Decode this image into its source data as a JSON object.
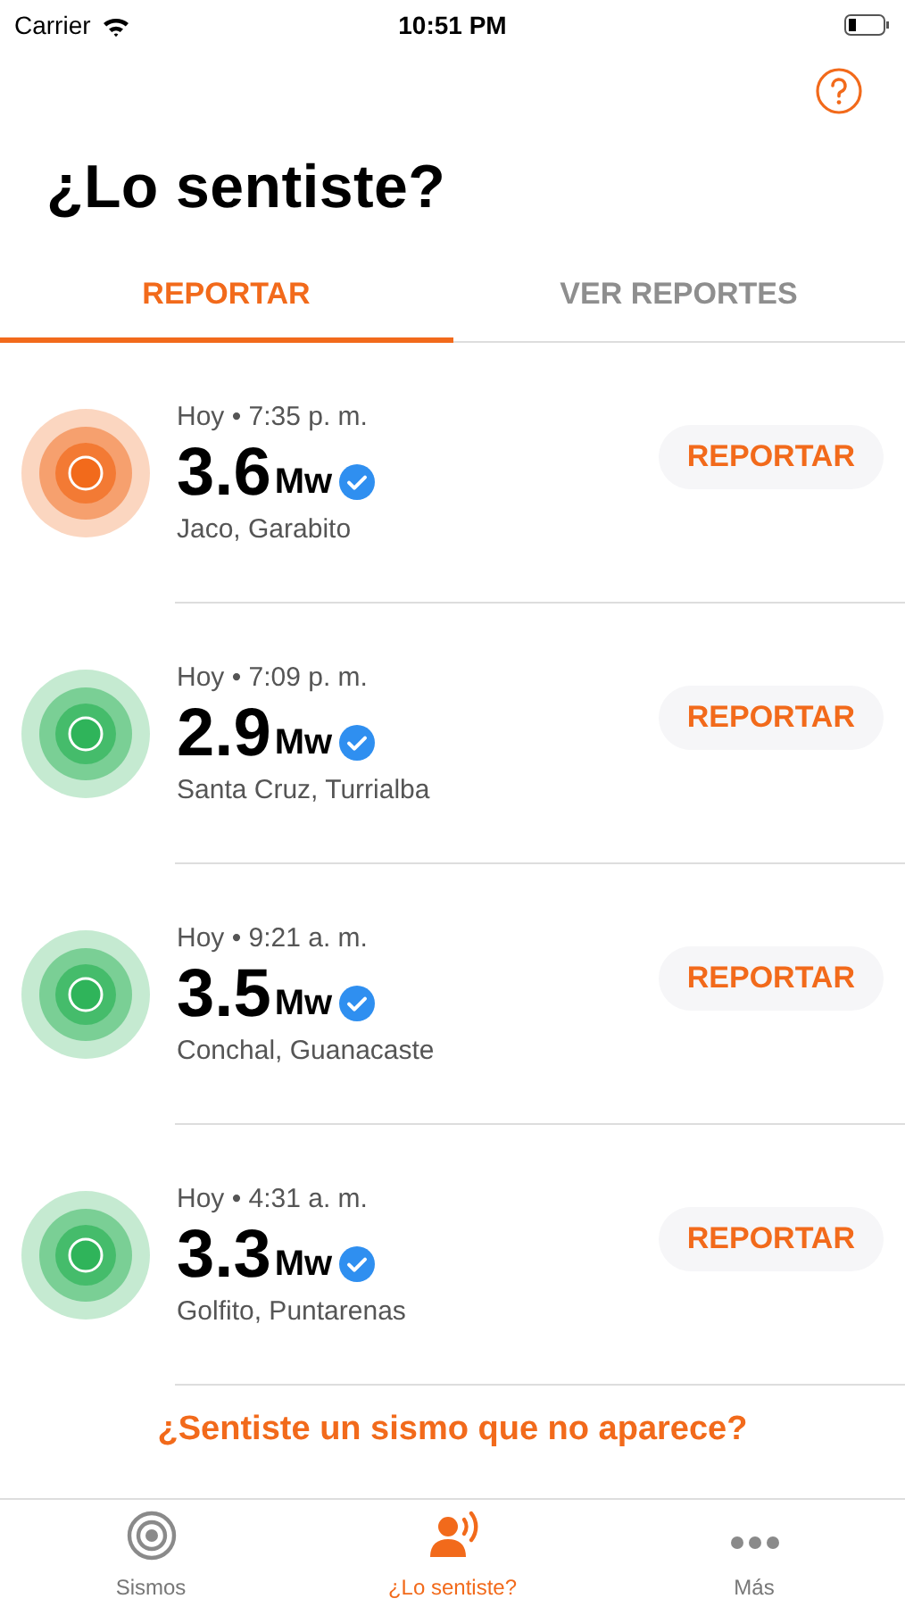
{
  "status_bar": {
    "carrier": "Carrier",
    "time": "10:51 PM"
  },
  "title": "¿Lo sentiste?",
  "tabs": [
    {
      "label": "REPORTAR",
      "selected": true
    },
    {
      "label": "VER REPORTES",
      "selected": false
    }
  ],
  "quakes": [
    {
      "time": "Hoy • 7:35 p. m.",
      "magnitude": "3.6",
      "unit": "Mw",
      "verified": true,
      "place": "Jaco, Garabito",
      "color": "#f26a1b",
      "action": "REPORTAR"
    },
    {
      "time": "Hoy • 7:09 p. m.",
      "magnitude": "2.9",
      "unit": "Mw",
      "verified": true,
      "place": "Santa Cruz, Turrialba",
      "color": "#2fb45a",
      "action": "REPORTAR"
    },
    {
      "time": "Hoy • 9:21 a. m.",
      "magnitude": "3.5",
      "unit": "Mw",
      "verified": true,
      "place": "Conchal, Guanacaste",
      "color": "#2fb45a",
      "action": "REPORTAR"
    },
    {
      "time": "Hoy • 4:31 a. m.",
      "magnitude": "3.3",
      "unit": "Mw",
      "verified": true,
      "place": "Golfito, Puntarenas",
      "color": "#2fb45a",
      "action": "REPORTAR"
    }
  ],
  "missing_link": "¿Sentiste un sismo que no aparece?",
  "tab_bar": [
    {
      "kind": "target",
      "label": "Sismos",
      "selected": false
    },
    {
      "kind": "speaker",
      "label": "¿Lo sentiste?",
      "selected": true
    },
    {
      "kind": "more",
      "label": "Más",
      "selected": false
    }
  ]
}
